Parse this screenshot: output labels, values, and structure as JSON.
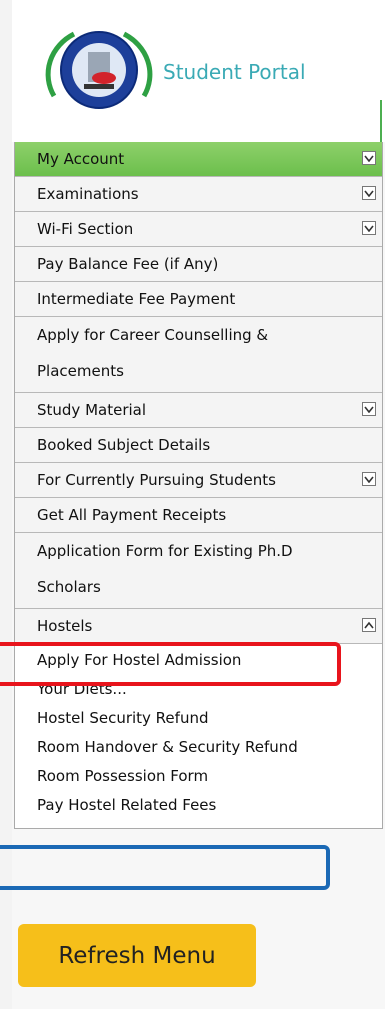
{
  "portal": {
    "title": "Student Portal"
  },
  "menu": {
    "items": [
      {
        "label": "My Account",
        "chevron": "down",
        "style": "green"
      },
      {
        "label": "Examinations",
        "chevron": "down"
      },
      {
        "label": "Wi-Fi Section",
        "chevron": "down"
      },
      {
        "label": "Pay Balance Fee (if Any)"
      },
      {
        "label": "Intermediate Fee Payment"
      },
      {
        "label": "Apply for Career Counselling & Placements",
        "tall": true
      },
      {
        "label": "Study Material",
        "chevron": "down"
      },
      {
        "label": "Booked Subject Details"
      },
      {
        "label": "For Currently Pursuing Students",
        "chevron": "down"
      },
      {
        "label": "Get All Payment Receipts"
      },
      {
        "label": "Application Form for Existing Ph.D Scholars",
        "tall": true
      },
      {
        "label": "Hostels",
        "chevron": "up"
      }
    ],
    "hostel_subitems": [
      "Apply For Hostel Admission",
      "Your Diets...",
      "Hostel Security Refund",
      "Room Handover & Security Refund",
      "Room Possession Form",
      "Pay Hostel Related Fees"
    ]
  },
  "refresh_button": {
    "label": "Refresh Menu"
  },
  "colors": {
    "accent_green": "#6cbf4c",
    "title_teal": "#3aaab5",
    "highlight_red": "#e8141c",
    "highlight_blue": "#1b69b5",
    "button_yellow": "#f6bf1a"
  }
}
